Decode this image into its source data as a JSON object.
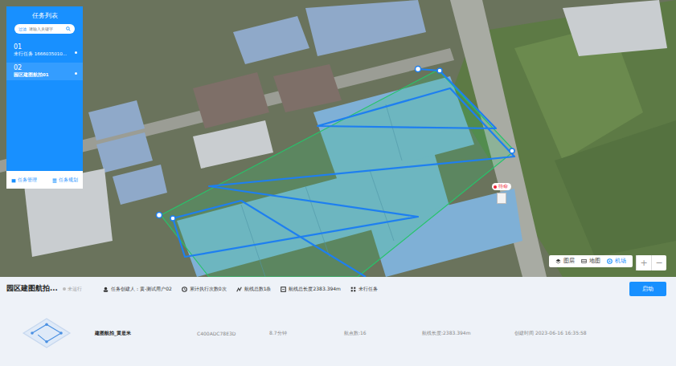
{
  "task_panel": {
    "title": "任务列表",
    "search": {
      "filter_label": "过滤",
      "placeholder": "请输入关键字"
    },
    "items": [
      {
        "index": "01",
        "label": "未行任务 1666035010...",
        "selected": false
      },
      {
        "index": "02",
        "label": "园区建图航拍01",
        "selected": true
      }
    ],
    "footer": [
      "任务管理",
      "任务规划"
    ]
  },
  "map": {
    "marker": {
      "label": "待命"
    },
    "controls": [
      {
        "label": "图层",
        "selected": false
      },
      {
        "label": "地图",
        "selected": false
      },
      {
        "label": "机场",
        "selected": true
      }
    ],
    "zoom": [
      "+",
      "−"
    ]
  },
  "detail": {
    "title": "园区建图航拍...",
    "status": "未运行",
    "stats": [
      "任务创建人：黄-测试用户02",
      "累计执行次数0次",
      "航线总数1条",
      "航线总长度2383.394m",
      "未行任务"
    ],
    "button": "启动",
    "route": {
      "name": "建图航拍_黄是米",
      "code": "C400ADC78E3D",
      "duration": "8.7分钟",
      "waypoints": "航点数:16",
      "length": "航线长度:2383.394m",
      "created": "创建时间 2023-06-16 16:35:58"
    }
  }
}
